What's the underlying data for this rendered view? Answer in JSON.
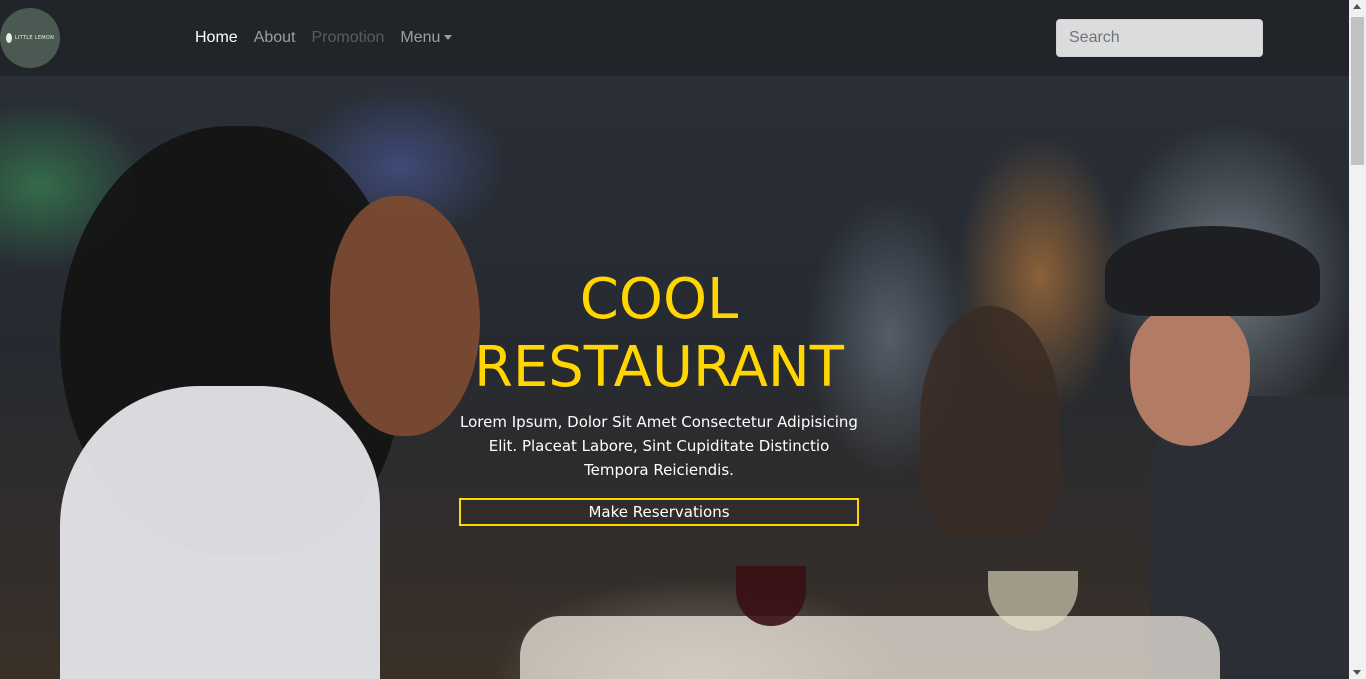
{
  "logo": {
    "text": "LITTLE LEMON"
  },
  "nav": {
    "items": [
      {
        "label": "Home"
      },
      {
        "label": "About"
      },
      {
        "label": "Promotion"
      },
      {
        "label": "Menu"
      }
    ]
  },
  "search": {
    "placeholder": "Search"
  },
  "hero": {
    "title": "COOL RESTAURANT",
    "text": "Lorem Ipsum, Dolor Sit Amet Consectetur Adipisicing Elit. Placeat Labore, Sint Cupiditate Distinctio Tempora Reiciendis.",
    "button_label": "Make Reservations"
  },
  "colors": {
    "navbar": "#212529",
    "accent_yellow": "#ffd600",
    "logo_bg": "#4a5a52"
  },
  "icons": {
    "menu_dropdown": "caret-down-icon"
  }
}
